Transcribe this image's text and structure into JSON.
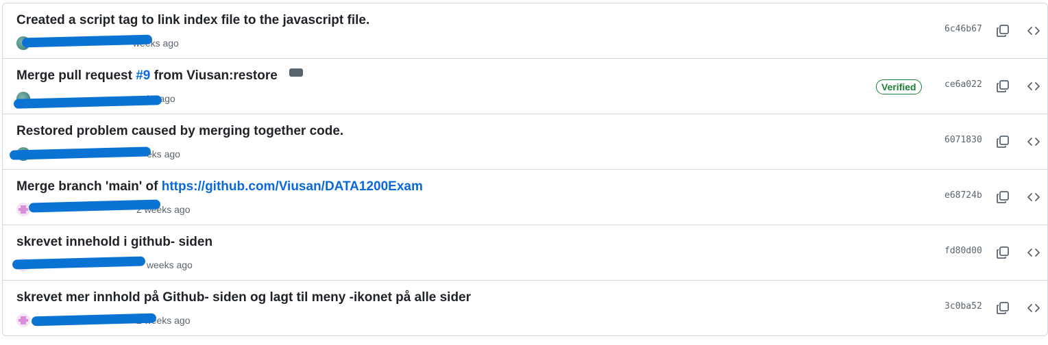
{
  "commits": [
    {
      "message": "Created a script tag to link index file to the javascript file.",
      "time": "weeks ago",
      "sha": "6c46b67",
      "verified": false,
      "avatar": "photo-avatar"
    },
    {
      "message_prefix": "Merge pull request ",
      "message_link": "#9",
      "message_suffix": " from Viusan:restore",
      "time": "eeks ago",
      "sha": "ce6a022",
      "verified": true,
      "verified_label": "Verified",
      "avatar": "photo-avatar"
    },
    {
      "message": "Restored problem caused by merging together code.",
      "time": "eks ago",
      "sha": "6071830",
      "verified": false,
      "avatar": "photo-avatar"
    },
    {
      "message_prefix": "Merge branch 'main' of ",
      "message_link": "https://github.com/Viusan/DATA1200Exam",
      "time": "2 weeks ago",
      "sha": "e68724b",
      "verified": false,
      "avatar": "identicon-avatar"
    },
    {
      "message": "skrevet innehold i github- siden",
      "time": "weeks ago",
      "sha": "fd80d00",
      "verified": false,
      "avatar": "identicon-avatar"
    },
    {
      "message": "skrevet mer innhold på Github- siden og lagt til meny -ikonet på alle sider",
      "time": "2 weeks ago",
      "sha": "3c0ba52",
      "verified": false,
      "avatar": "identicon-avatar"
    }
  ],
  "icons": {
    "copy": "copy-icon",
    "browse": "code-icon"
  },
  "colors": {
    "link": "#0969da",
    "verified": "#1a7f37",
    "redaction": "#0b73d4"
  }
}
